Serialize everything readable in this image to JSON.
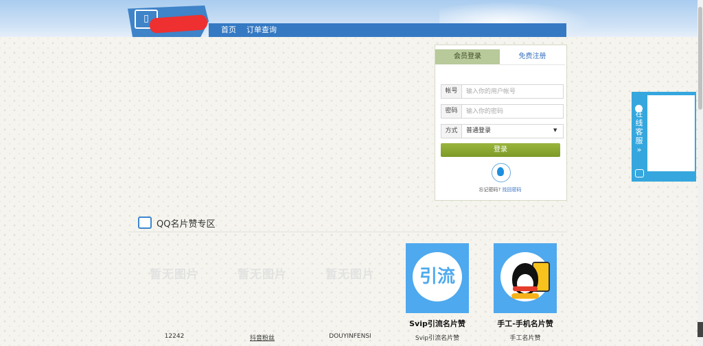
{
  "nav": {
    "home": "首页",
    "orders": "订单查询"
  },
  "login": {
    "tab_login": "会员登录",
    "tab_register": "免费注册",
    "account_label": "帐号",
    "account_placeholder": "输入你的用户帐号",
    "password_label": "密码",
    "password_placeholder": "输入你的密码",
    "method_label": "方式",
    "method_value": "普通登录",
    "submit": "登录",
    "forgot_prefix": "忘记密码?",
    "forgot_link": "找回密码"
  },
  "service": {
    "label": "在线客服",
    "arrow": "»"
  },
  "section": {
    "title": "QQ名片赞专区"
  },
  "products": [
    {
      "caption": "12242",
      "placeholder": "暂无图片"
    },
    {
      "caption": "抖音粉丝",
      "placeholder": "暂无图片"
    },
    {
      "caption": "DOUYINFENSI",
      "placeholder": "暂无图片"
    },
    {
      "caption": "Svip引流名片赞",
      "title": "Svip引流名片赞",
      "image_text": "引流"
    },
    {
      "caption": "手工名片赞",
      "title": "手工-手机名片赞"
    }
  ],
  "colors": {
    "nav_blue": "#3579c3",
    "login_green": "#8aa832",
    "service_blue": "#35a7de",
    "product_blue": "#4ea9ee"
  }
}
